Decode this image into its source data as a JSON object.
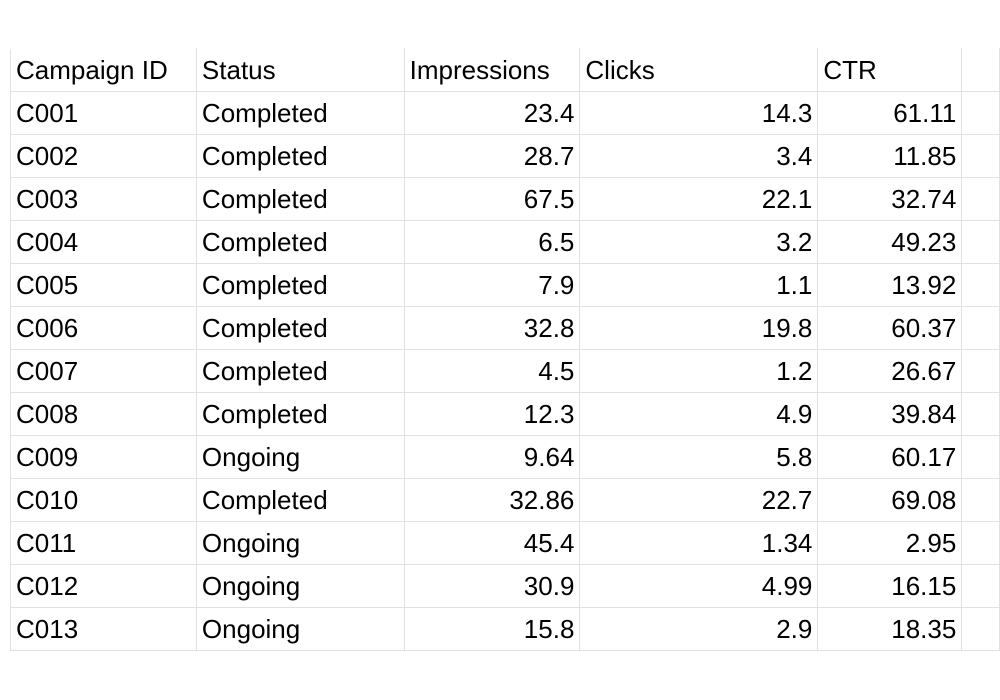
{
  "sheet": {
    "headers": [
      "Campaign ID",
      "Status",
      "Impressions",
      "Clicks",
      "CTR",
      ""
    ],
    "rows": [
      {
        "id": "C001",
        "status": "Completed",
        "impressions": "23.4",
        "clicks": "14.3",
        "ctr": "61.11"
      },
      {
        "id": "C002",
        "status": "Completed",
        "impressions": "28.7",
        "clicks": "3.4",
        "ctr": "11.85"
      },
      {
        "id": "C003",
        "status": "Completed",
        "impressions": "67.5",
        "clicks": "22.1",
        "ctr": "32.74"
      },
      {
        "id": "C004",
        "status": "Completed",
        "impressions": "6.5",
        "clicks": "3.2",
        "ctr": "49.23"
      },
      {
        "id": "C005",
        "status": "Completed",
        "impressions": "7.9",
        "clicks": "1.1",
        "ctr": "13.92"
      },
      {
        "id": "C006",
        "status": "Completed",
        "impressions": "32.8",
        "clicks": "19.8",
        "ctr": "60.37"
      },
      {
        "id": "C007",
        "status": "Completed",
        "impressions": "4.5",
        "clicks": "1.2",
        "ctr": "26.67"
      },
      {
        "id": "C008",
        "status": "Completed",
        "impressions": "12.3",
        "clicks": "4.9",
        "ctr": "39.84"
      },
      {
        "id": "C009",
        "status": "Ongoing",
        "impressions": "9.64",
        "clicks": "5.8",
        "ctr": "60.17"
      },
      {
        "id": "C010",
        "status": "Completed",
        "impressions": "32.86",
        "clicks": "22.7",
        "ctr": "69.08"
      },
      {
        "id": "C011",
        "status": "Ongoing",
        "impressions": "45.4",
        "clicks": "1.34",
        "ctr": "2.95"
      },
      {
        "id": "C012",
        "status": "Ongoing",
        "impressions": "30.9",
        "clicks": "4.99",
        "ctr": "16.15"
      },
      {
        "id": "C013",
        "status": "Ongoing",
        "impressions": "15.8",
        "clicks": "2.9",
        "ctr": "18.35"
      }
    ]
  }
}
